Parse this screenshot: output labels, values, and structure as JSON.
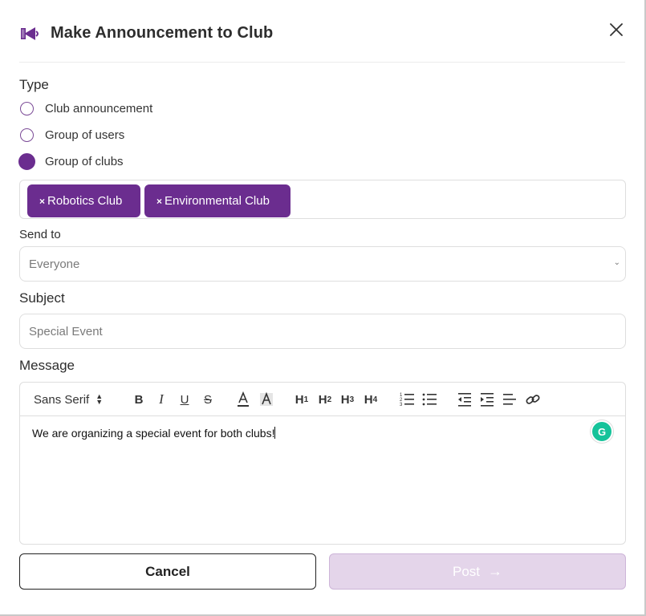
{
  "header": {
    "title": "Make Announcement to Club",
    "icon": "megaphone-icon",
    "close_icon": "close-icon"
  },
  "type": {
    "label": "Type",
    "options": [
      {
        "label": "Club announcement",
        "checked": false
      },
      {
        "label": "Group of users",
        "checked": false
      },
      {
        "label": "Group of clubs",
        "checked": true
      }
    ]
  },
  "selected_clubs": [
    {
      "remove": "×",
      "label": "Robotics Club"
    },
    {
      "remove": "×",
      "label": "Environmental Club"
    }
  ],
  "send_to": {
    "label": "Send to",
    "value": "Everyone"
  },
  "subject": {
    "label": "Subject",
    "value": "Special Event"
  },
  "message": {
    "label": "Message",
    "font": "Sans Serif",
    "body": "We are organizing a special event for both clubs!",
    "toolbar": {
      "bold": "B",
      "italic": "I",
      "underline": "U",
      "strike": "S",
      "h1": "H",
      "h1_sub": "1",
      "h2": "H",
      "h2_sub": "2",
      "h3": "H",
      "h3_sub": "3",
      "h4": "H",
      "h4_sub": "4"
    }
  },
  "actions": {
    "cancel": "Cancel",
    "post": "Post",
    "post_arrow": "→"
  },
  "colors": {
    "accent": "#6b2d8f",
    "post_disabled_bg": "#e4d5ea"
  }
}
